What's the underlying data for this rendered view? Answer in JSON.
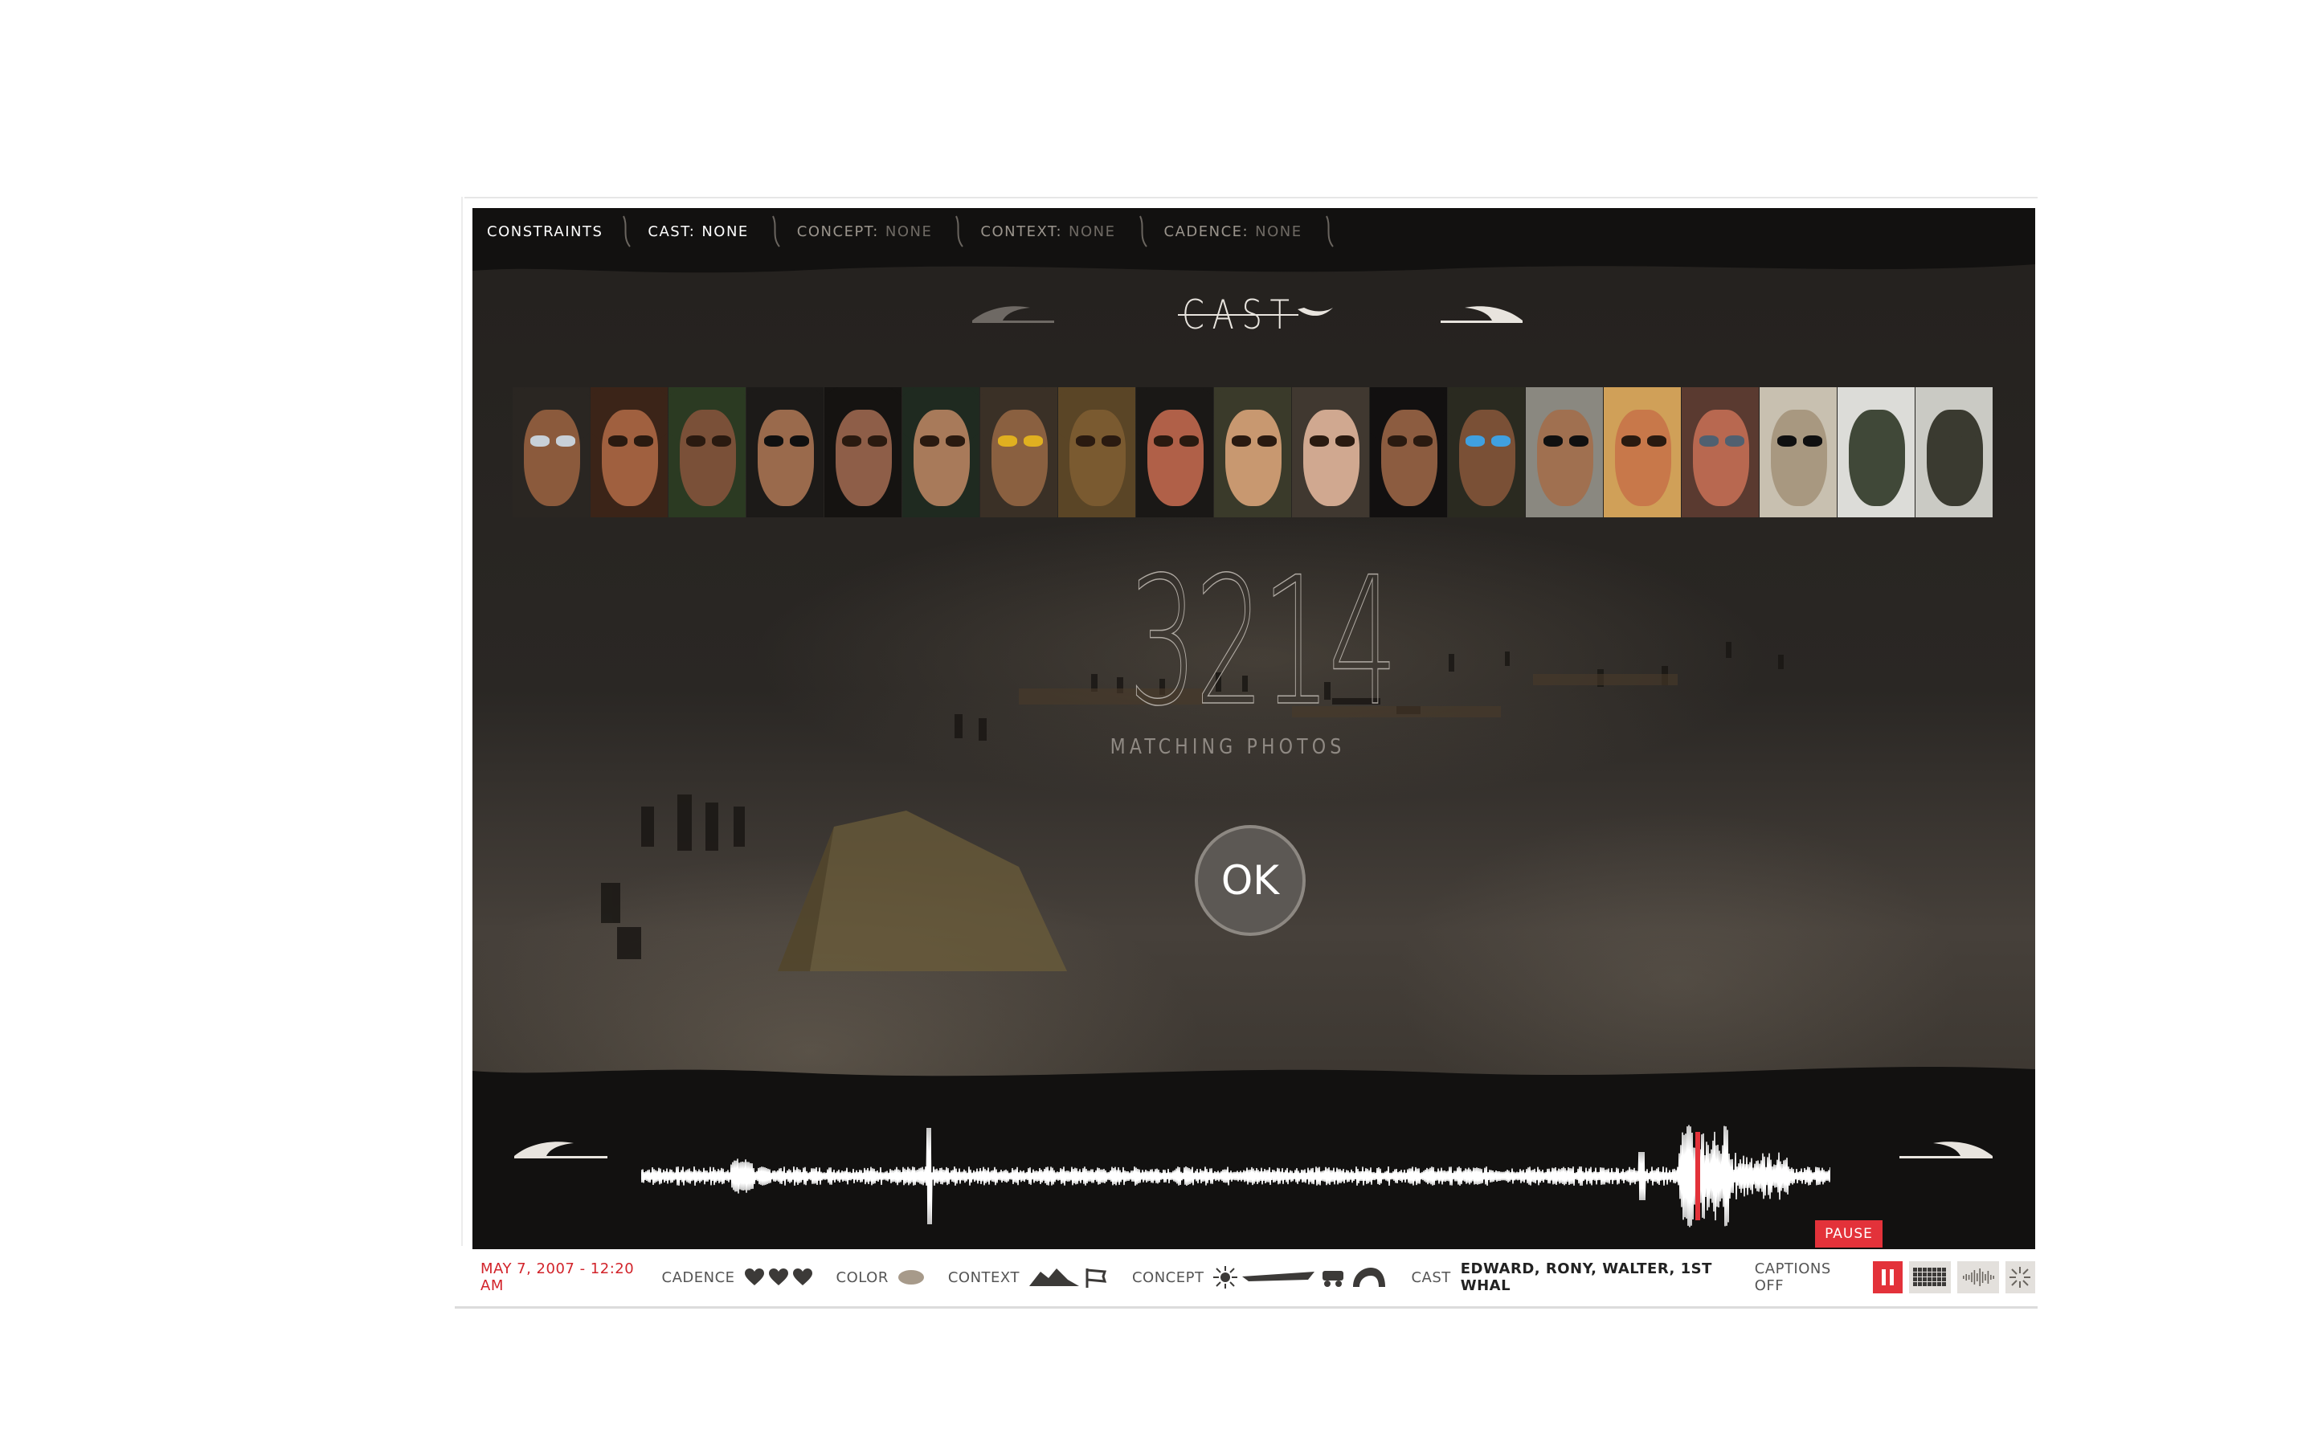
{
  "constraints_bar": {
    "title": "CONSTRAINTS",
    "items": [
      {
        "key": "CAST:",
        "value": "NONE",
        "active": true
      },
      {
        "key": "CONCEPT:",
        "value": "NONE",
        "active": false
      },
      {
        "key": "CONTEXT:",
        "value": "NONE",
        "active": false
      },
      {
        "key": "CADENCE:",
        "value": "NONE",
        "active": false
      }
    ]
  },
  "selector": {
    "title": "CAST",
    "prev_icon": "left-arrow-icon",
    "next_icon": "right-arrow-icon"
  },
  "faces": [
    {
      "id": "face-1",
      "skin": "#8b5a3c",
      "hood": "#2a2622",
      "eye": "#c8d0d8"
    },
    {
      "id": "face-2",
      "skin": "#a0603f",
      "hood": "#3b2418",
      "eye": "#2a1a10"
    },
    {
      "id": "face-3",
      "skin": "#7a5038",
      "hood": "#2b3a22",
      "eye": "#2a1a10"
    },
    {
      "id": "face-4",
      "skin": "#9a6a4c",
      "hood": "#1c1a18",
      "eye": "#101010"
    },
    {
      "id": "face-5",
      "skin": "#8e5e48",
      "hood": "#151311",
      "eye": "#2a1a10"
    },
    {
      "id": "face-6",
      "skin": "#a87a5a",
      "hood": "#1f2a20",
      "eye": "#2a1a10"
    },
    {
      "id": "face-7",
      "skin": "#8a6040",
      "hood": "#3a3026",
      "eye": "#e0b020"
    },
    {
      "id": "face-8",
      "skin": "#7a5a30",
      "hood": "#5a4526",
      "eye": "#2a1a10"
    },
    {
      "id": "face-9",
      "skin": "#b06048",
      "hood": "#1a1816",
      "eye": "#2a1a10"
    },
    {
      "id": "face-10",
      "skin": "#c89870",
      "hood": "#3a3a2a",
      "eye": "#2a1a10"
    },
    {
      "id": "face-11",
      "skin": "#d0a890",
      "hood": "#403830",
      "eye": "#2a1a10"
    },
    {
      "id": "face-12",
      "skin": "#8c5c40",
      "hood": "#121010",
      "eye": "#2a1a10"
    },
    {
      "id": "face-13",
      "skin": "#7a5036",
      "hood": "#2a2a20",
      "eye": "#40a0e0"
    },
    {
      "id": "face-14",
      "skin": "#a07050",
      "hood": "#8a8880",
      "eye": "#101010"
    },
    {
      "id": "face-15",
      "skin": "#c8784a",
      "hood": "#d0a058",
      "eye": "#2a1a10"
    },
    {
      "id": "face-16",
      "skin": "#b86850",
      "hood": "#5a3a30",
      "eye": "#506070"
    },
    {
      "id": "face-17",
      "skin": "#a89880",
      "hood": "#c8c0b0",
      "eye": "#101010"
    },
    {
      "id": "face-18",
      "skin": "#404838",
      "hood": "#dcdcd8",
      "eye": "#404838"
    },
    {
      "id": "face-19",
      "skin": "#3a3a30",
      "hood": "#cacac4",
      "eye": "#3a3a30"
    }
  ],
  "results": {
    "count": "3214",
    "label": "MATCHING PHOTOS"
  },
  "ok_button": {
    "label": "OK"
  },
  "status_bar": {
    "date": "MAY 7, 2007 - 12:20 AM",
    "cadence_label": "CADENCE",
    "color_label": "COLOR",
    "color_swatch": "#a79a8a",
    "context_label": "CONTEXT",
    "concept_label": "CONCEPT",
    "cast_label": "CAST",
    "cast_value": "EDWARD, RONY, WALTER, 1ST WHAL",
    "captions_label": "CAPTIONS OFF",
    "pause_label": "PAUSE"
  },
  "colors": {
    "accent_red": "#e3323a",
    "date_red": "#d2232a",
    "background_dark": "#121110"
  }
}
